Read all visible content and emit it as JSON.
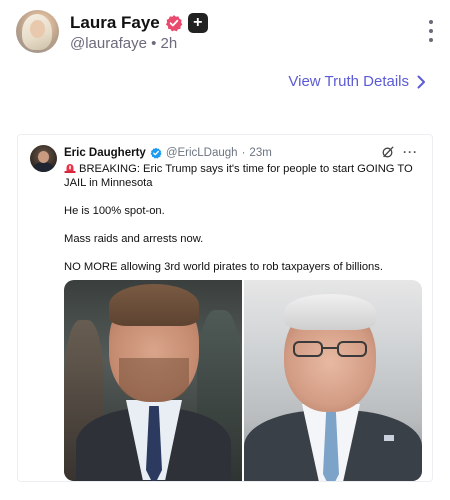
{
  "post": {
    "author_name": "Laura Faye",
    "handle": "@laurafaye",
    "separator": "•",
    "time": "2h",
    "plus_badge": "+",
    "view_details": "View Truth Details",
    "icons": [
      "verified-icon",
      "plus-badge-icon",
      "more-vert-icon",
      "chevron-right-icon"
    ],
    "colors": {
      "link": "#5b5bd6",
      "verified": "#e84b6e",
      "handle": "#6b6b7b"
    }
  },
  "quote": {
    "author_name": "Eric Daugherty",
    "handle": "@EricLDaugh",
    "separator": "·",
    "time": "23m",
    "more": "···",
    "body": [
      "BREAKING: Eric Trump says it's time for people to start GOING TO JAIL in Minnesota",
      "He is 100% spot-on.",
      "Mass raids and arrests now.",
      "NO MORE allowing 3rd world pirates to rob taxpayers of billions."
    ],
    "icons": [
      "siren-icon",
      "verified-icon",
      "grok-icon",
      "more-horizontal-icon"
    ],
    "colors": {
      "verified": "#1d9bf0",
      "handle": "#6b7580"
    }
  }
}
